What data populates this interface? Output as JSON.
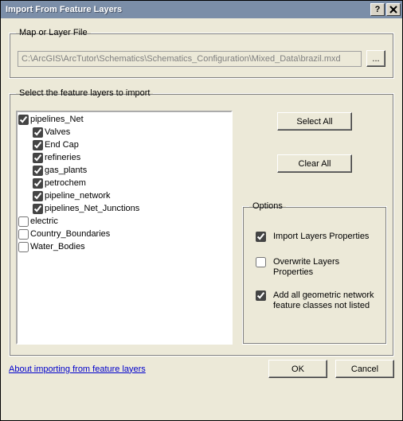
{
  "window": {
    "title": "Import From Feature Layers"
  },
  "mapGroup": {
    "legend": "Map or Layer File",
    "path": "C:\\ArcGIS\\ArcTutor\\Schematics\\Schematics_Configuration\\Mixed_Data\\brazil.mxd",
    "browse_label": "..."
  },
  "layersGroup": {
    "legend": "Select the feature layers to import",
    "items": [
      {
        "label": "pipelines_Net",
        "checked": true,
        "indent": false
      },
      {
        "label": "Valves",
        "checked": true,
        "indent": true
      },
      {
        "label": "End Cap",
        "checked": true,
        "indent": true
      },
      {
        "label": "refineries",
        "checked": true,
        "indent": true
      },
      {
        "label": "gas_plants",
        "checked": true,
        "indent": true
      },
      {
        "label": "petrochem",
        "checked": true,
        "indent": true
      },
      {
        "label": "pipeline_network",
        "checked": true,
        "indent": true
      },
      {
        "label": "pipelines_Net_Junctions",
        "checked": true,
        "indent": true
      },
      {
        "label": "electric",
        "checked": false,
        "indent": false
      },
      {
        "label": "Country_Boundaries",
        "checked": false,
        "indent": false
      },
      {
        "label": "Water_Bodies",
        "checked": false,
        "indent": false
      }
    ],
    "select_all": "Select All",
    "clear_all": "Clear All"
  },
  "optionsGroup": {
    "legend": "Options",
    "opt1": {
      "label": "Import Layers Properties",
      "checked": true
    },
    "opt2": {
      "label": "Overwrite Layers Properties",
      "checked": false
    },
    "opt3": {
      "label": "Add all geometric network feature classes not listed",
      "checked": true
    }
  },
  "footer": {
    "help_link": "About importing from feature layers",
    "ok": "OK",
    "cancel": "Cancel"
  }
}
